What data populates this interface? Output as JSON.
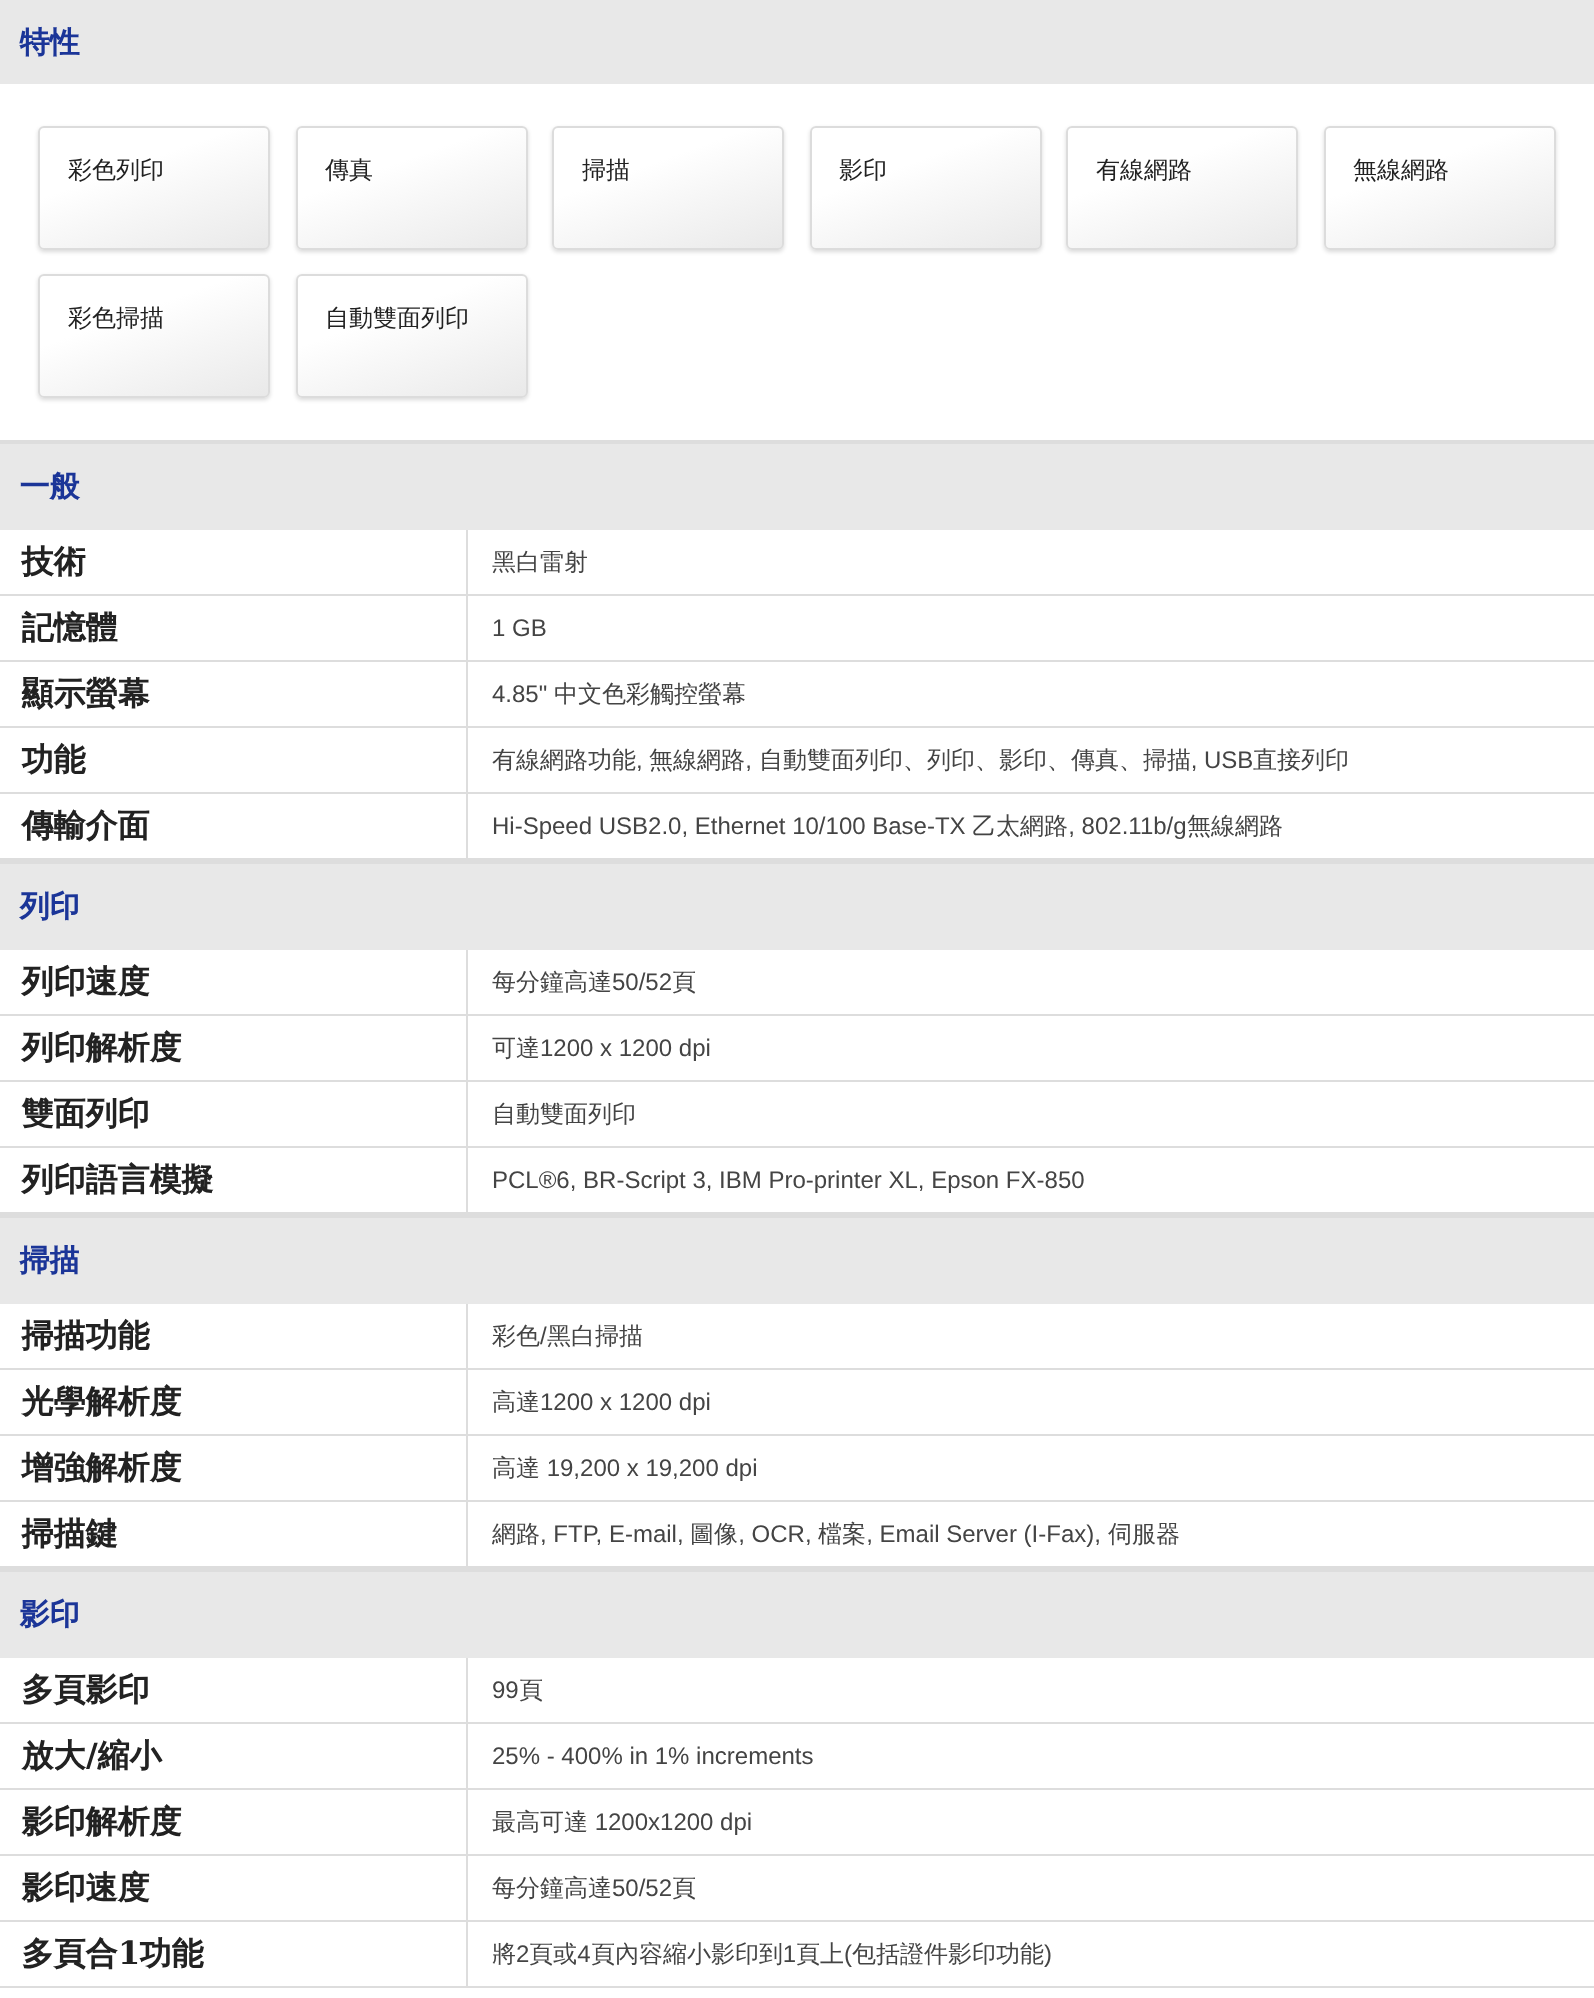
{
  "features": {
    "title": "特性",
    "items": [
      "彩色列印",
      "傳真",
      "掃描",
      "影印",
      "有線網路",
      "無線網路",
      "彩色掃描",
      "自動雙面列印"
    ]
  },
  "sections": [
    {
      "title": "一般",
      "rows": [
        {
          "label": "技術",
          "value": "黑白雷射"
        },
        {
          "label": "記憶體",
          "value": "1 GB"
        },
        {
          "label": "顯示螢幕",
          "value": "4.85\" 中文色彩觸控螢幕"
        },
        {
          "label": "功能",
          "value": "有線網路功能, 無線網路, 自動雙面列印、列印、影印、傳真、掃描, USB直接列印"
        },
        {
          "label": "傳輸介面",
          "value": "Hi-Speed USB2.0, Ethernet 10/100 Base-TX 乙太網路, 802.11b/g無線網路"
        }
      ]
    },
    {
      "title": "列印",
      "rows": [
        {
          "label": "列印速度",
          "value": "每分鐘高達50/52頁"
        },
        {
          "label": "列印解析度",
          "value": "可達1200 x 1200 dpi"
        },
        {
          "label": "雙面列印",
          "value": "自動雙面列印"
        },
        {
          "label": "列印語言模擬",
          "value": "PCL®6, BR-Script 3, IBM Pro-printer XL, Epson FX-850"
        }
      ]
    },
    {
      "title": "掃描",
      "rows": [
        {
          "label": "掃描功能",
          "value": "彩色/黑白掃描"
        },
        {
          "label": "光學解析度",
          "value": "高達1200 x 1200 dpi"
        },
        {
          "label": "增強解析度",
          "value": "高達 19,200 x 19,200 dpi"
        },
        {
          "label": "掃描鍵",
          "value": "網路, FTP, E-mail, 圖像, OCR, 檔案, Email Server (I-Fax), 伺服器"
        }
      ]
    },
    {
      "title": "影印",
      "rows": [
        {
          "label": "多頁影印",
          "value": "99頁"
        },
        {
          "label": "放大/縮小",
          "value": "25% - 400% in 1% increments"
        },
        {
          "label": "影印解析度",
          "value": "最高可達 1200x1200 dpi"
        },
        {
          "label": "影印速度",
          "value": "每分鐘高達50/52頁"
        },
        {
          "label": "多頁合1功能",
          "value": "將2頁或4頁內容縮小影印到1頁上(包括證件影印功能)"
        }
      ]
    }
  ]
}
